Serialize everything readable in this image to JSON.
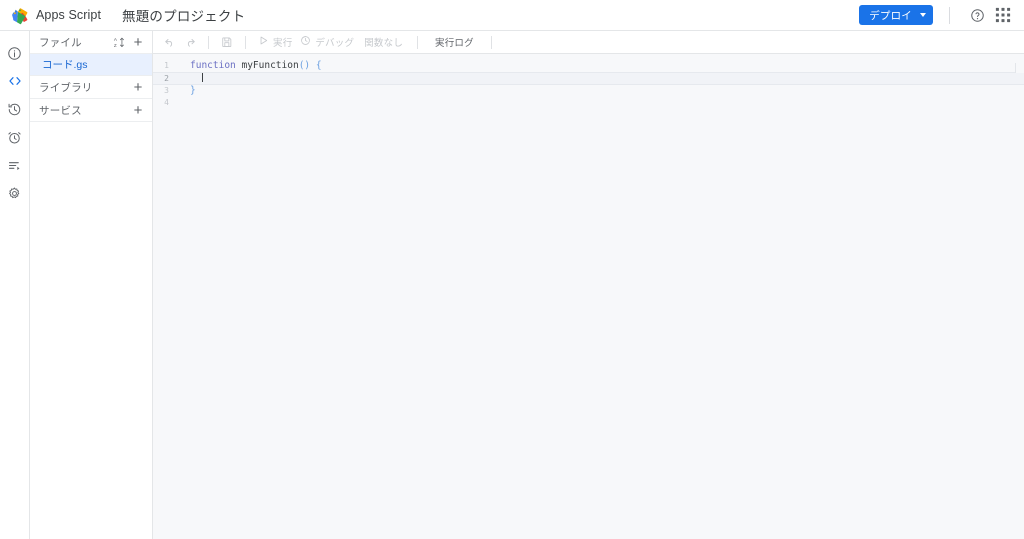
{
  "header": {
    "logo_icon": "apps-script-logo",
    "product_name": "Apps Script",
    "project_title": "無題のプロジェクト",
    "deploy_label": "デプロイ",
    "deploy_color": "#1a73e8",
    "help_icon": "help-circle-icon",
    "apps_icon": "apps-grid-icon"
  },
  "rail": {
    "items": [
      {
        "icon": "info-icon",
        "name": "overview",
        "active": false
      },
      {
        "icon": "code-icon",
        "name": "editor",
        "active": true
      },
      {
        "icon": "history-icon",
        "name": "executions",
        "active": false
      },
      {
        "icon": "alarm-icon",
        "name": "triggers",
        "active": false
      },
      {
        "icon": "logs-icon",
        "name": "execution-log",
        "active": false
      },
      {
        "icon": "gear-icon",
        "name": "settings",
        "active": false
      }
    ]
  },
  "files_panel": {
    "sections": [
      {
        "label": "ファイル",
        "sort_icon": "sort-az-icon",
        "add_icon": "plus-icon"
      },
      {
        "label": "ライブラリ",
        "sort_icon": null,
        "add_icon": "plus-icon"
      },
      {
        "label": "サービス",
        "sort_icon": null,
        "add_icon": "plus-icon"
      }
    ],
    "files": [
      {
        "name": "コード.gs",
        "selected": true
      }
    ]
  },
  "toolbar": {
    "undo_icon": "undo-icon",
    "redo_icon": "redo-icon",
    "save_icon": "save-icon",
    "run_icon": "play-icon",
    "run_label": "実行",
    "debug_icon": "debug-icon",
    "debug_label": "デバッグ",
    "function_select": "関数なし",
    "log_label": "実行ログ"
  },
  "editor": {
    "lines": [
      {
        "number": "1",
        "active": false,
        "tokens": [
          {
            "text": "function ",
            "type": "kw"
          },
          {
            "text": "myFunction",
            "type": "fn"
          },
          {
            "text": "()",
            "type": "punc"
          },
          {
            "text": " ",
            "type": "fn"
          },
          {
            "text": "{",
            "type": "brace"
          }
        ]
      },
      {
        "number": "2",
        "active": true,
        "tokens": [
          {
            "text": "  ",
            "type": "fn"
          }
        ]
      },
      {
        "number": "3",
        "active": false,
        "tokens": [
          {
            "text": "}",
            "type": "brace"
          }
        ]
      },
      {
        "number": "4",
        "active": false,
        "tokens": []
      }
    ]
  }
}
